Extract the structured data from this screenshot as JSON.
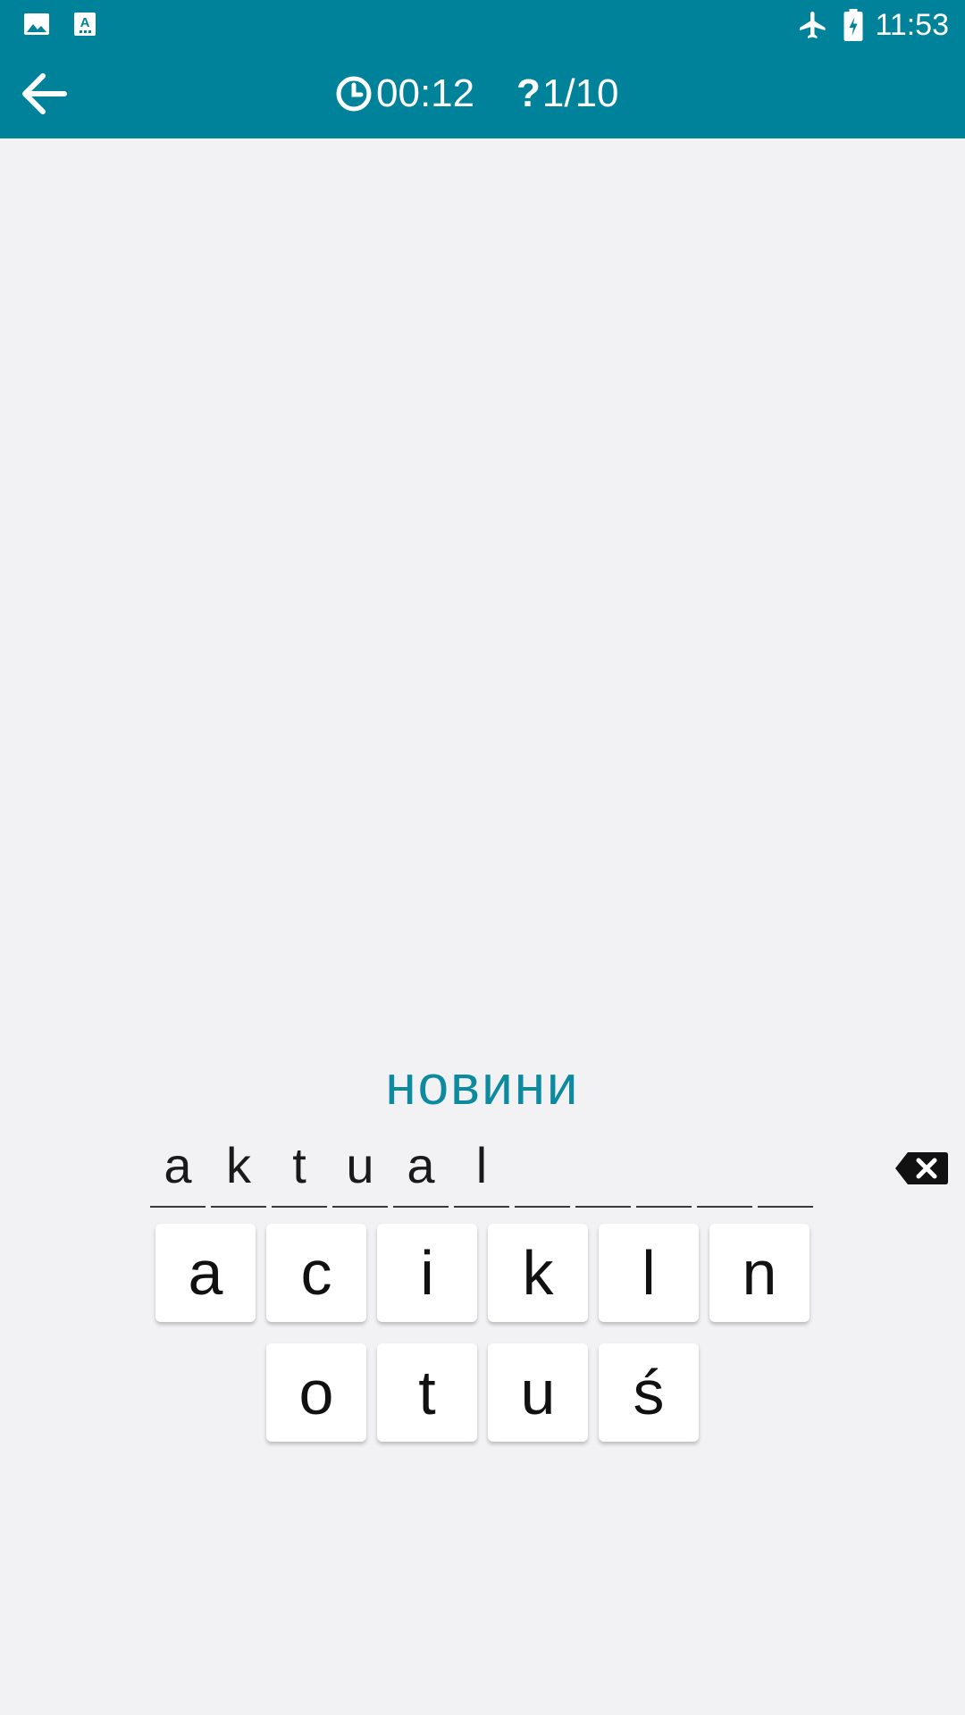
{
  "status_bar": {
    "time": "11:53",
    "left_icons": [
      "image-icon",
      "font-app-icon"
    ],
    "right_icons": [
      "airplane-mode-icon",
      "battery-charging-icon"
    ]
  },
  "app_bar": {
    "back_icon": "arrow-left-icon",
    "timer_icon": "clock-icon",
    "timer": "00:12",
    "question_icon": "question-mark-icon",
    "question_mark": "?",
    "progress": "1/10"
  },
  "quiz": {
    "prompt": "новини",
    "answer_slots": [
      "a",
      "k",
      "t",
      "u",
      "a",
      "l",
      "",
      "",
      "",
      "",
      ""
    ],
    "backspace_icon": "backspace-icon"
  },
  "keyboard": {
    "row1": [
      "a",
      "c",
      "i",
      "k",
      "l",
      "n"
    ],
    "row2": [
      "o",
      "t",
      "u",
      "ś"
    ]
  },
  "colors": {
    "primary": "#00829a",
    "prompt": "#0e8aa0",
    "background": "#f2f2f4"
  }
}
